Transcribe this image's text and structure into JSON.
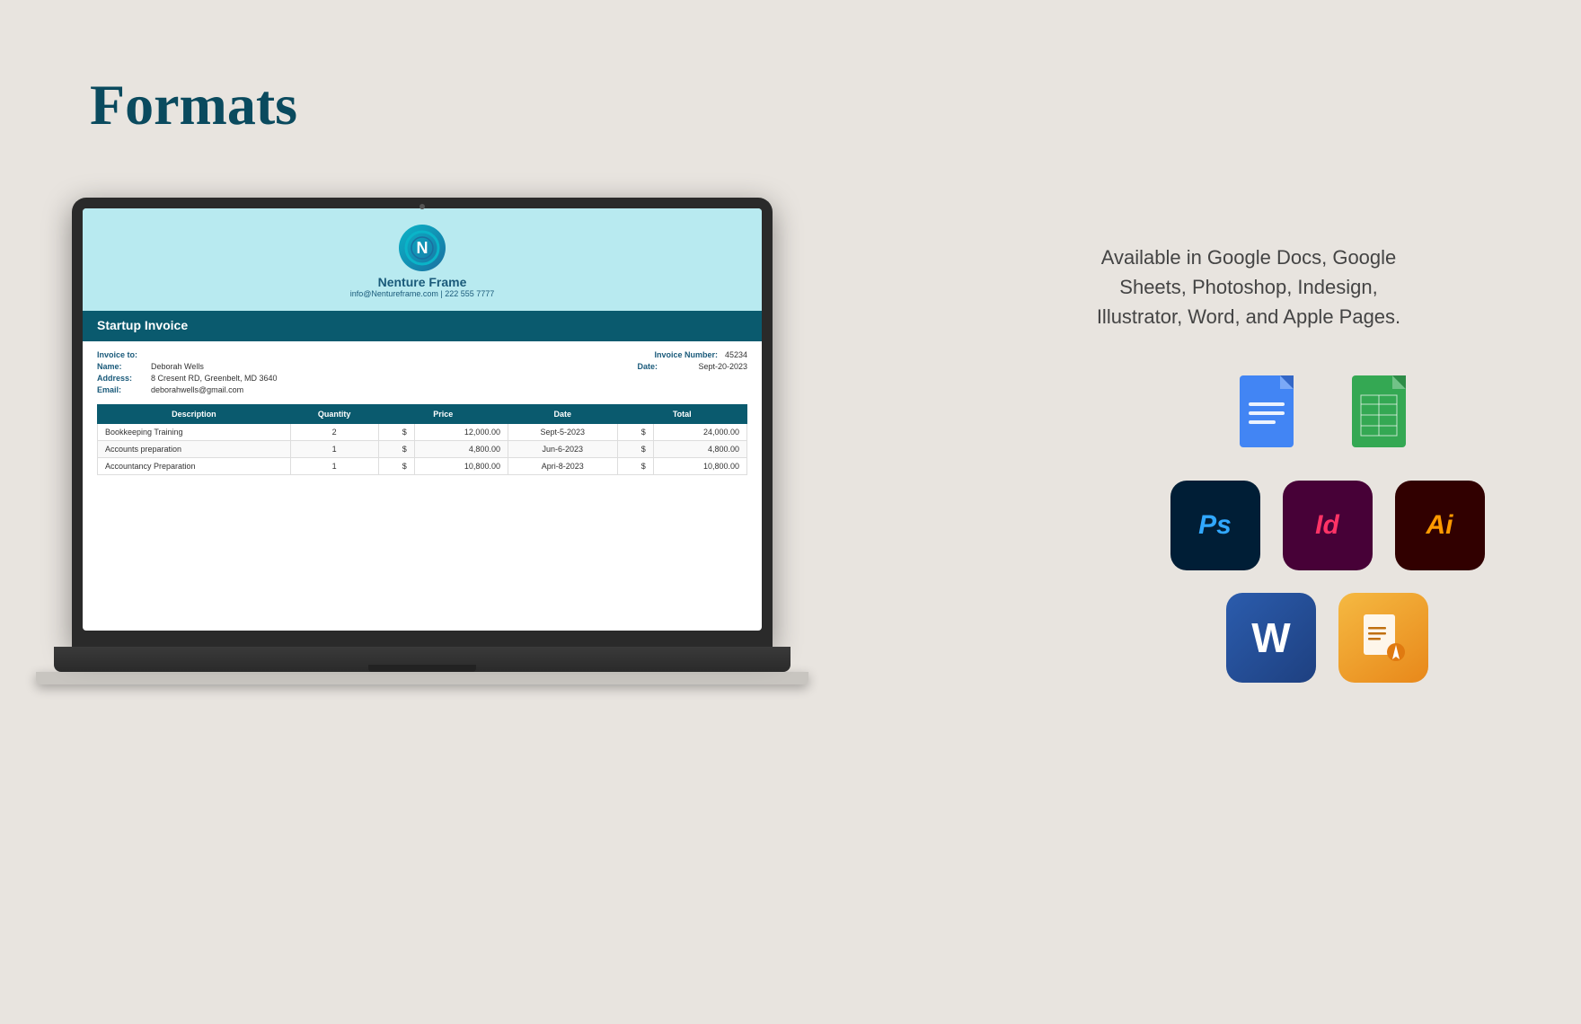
{
  "page": {
    "title": "Formats",
    "background_color": "#e8e4df"
  },
  "description": {
    "text": "Available in  Google Docs, Google Sheets, Photoshop, Indesign, Illustrator, Word, and Apple Pages."
  },
  "invoice": {
    "company": {
      "name": "Nenture Frame",
      "email": "info@Nentureframe.com | 222 555 7777",
      "logo_letter": "N"
    },
    "title": "Startup Invoice",
    "invoice_to_label": "Invoice to:",
    "name_label": "Name:",
    "name_value": "Deborah Wells",
    "address_label": "Address:",
    "address_value": "8 Cresent RD, Greenbelt, MD 3640",
    "email_label": "Email:",
    "email_value": "deborahwells@gmail.com",
    "invoice_number_label": "Invoice Number:",
    "invoice_number_value": "45234",
    "date_label": "Date:",
    "date_value": "Sept-20-2023",
    "table": {
      "headers": [
        "Description",
        "Quantity",
        "Price",
        "Date",
        "Total"
      ],
      "rows": [
        [
          "Bookkeeping Training",
          "2",
          "$",
          "12,000.00",
          "Sept-5-2023",
          "$",
          "24,000.00"
        ],
        [
          "Accounts preparation",
          "1",
          "$",
          "4,800.00",
          "Jun-6-2023",
          "$",
          "4,800.00"
        ],
        [
          "Accountancy Preparation",
          "1",
          "$",
          "10,800.00",
          "Apri-8-2023",
          "$",
          "10,800.00"
        ]
      ]
    }
  },
  "apps": [
    {
      "name": "Google Docs",
      "short": "Docs",
      "color": "#4285f4"
    },
    {
      "name": "Google Sheets",
      "short": "Sheets",
      "color": "#34a853"
    },
    {
      "name": "Photoshop",
      "short": "Ps",
      "bg": "#001e36",
      "fg": "#31a8ff"
    },
    {
      "name": "InDesign",
      "short": "Id",
      "bg": "#470137",
      "fg": "#ff3366"
    },
    {
      "name": "Illustrator",
      "short": "Ai",
      "bg": "#310000",
      "fg": "#ff9a00"
    },
    {
      "name": "Word",
      "short": "W",
      "bg": "#2b5797",
      "fg": "#ffffff"
    },
    {
      "name": "Apple Pages",
      "short": "Pages",
      "bg_start": "#f5a623",
      "bg_end": "#e8851a"
    }
  ]
}
